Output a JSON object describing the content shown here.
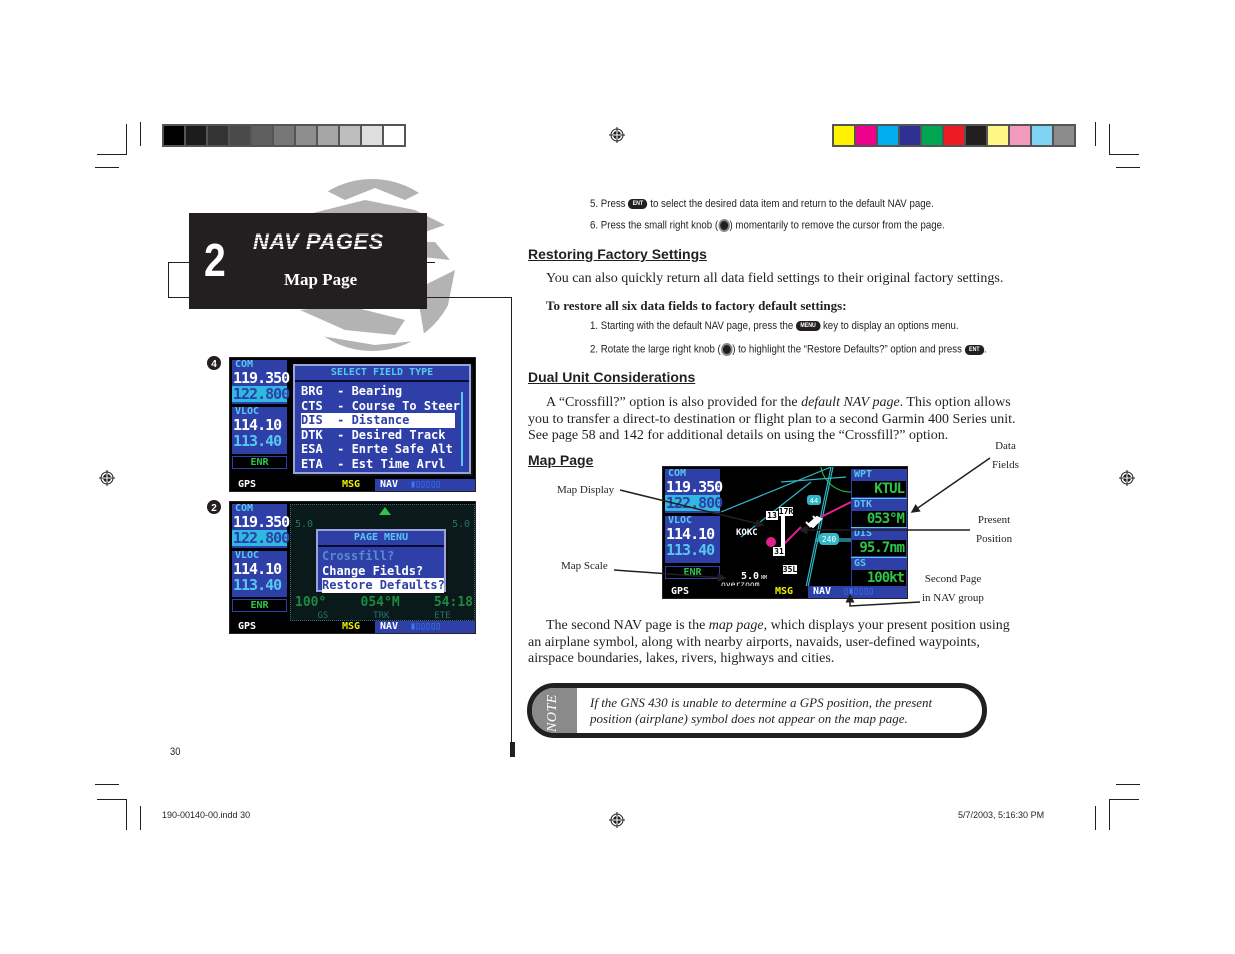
{
  "colors": {
    "gray_swatches": [
      "#000000",
      "#1c1c1c",
      "#333333",
      "#4a4a4a",
      "#5f5f5f",
      "#777777",
      "#8e8e8e",
      "#a6a6a6",
      "#bebebe",
      "#dedede",
      "#ffffff"
    ],
    "color_swatches": [
      "#fff200",
      "#ec008c",
      "#00aeef",
      "#2e3192",
      "#00a651",
      "#ed1c24",
      "#231f20",
      "#fff685",
      "#f49ac1",
      "#7fd4f5",
      "#8c8c8c"
    ],
    "gps_blue": "#2e3fa8",
    "gps_cyan": "#58c8f0",
    "gps_green": "#2ec44a",
    "route_magenta": "#e0208c"
  },
  "chapter": {
    "number": "2",
    "title": "NAV PAGES",
    "subtitle": "Map Page"
  },
  "figures": {
    "step4_marker": "4",
    "step2_marker": "2",
    "screen_select": {
      "com_label": "COM",
      "com_active": "119.350",
      "com_standby": "122.800",
      "vloc_label": "VLOC",
      "vloc_active": "114.10",
      "vloc_standby": "113.40",
      "mode": "ENR",
      "popup_title": "SELECT FIELD TYPE",
      "items": [
        {
          "code": "BRG",
          "desc": "Bearing"
        },
        {
          "code": "CTS",
          "desc": "Course To Steer"
        },
        {
          "code": "DIS",
          "desc": "Distance"
        },
        {
          "code": "DTK",
          "desc": "Desired Track"
        },
        {
          "code": "ESA",
          "desc": "Enrte Safe Alt"
        },
        {
          "code": "ETA",
          "desc": "Est Time Arvl"
        }
      ],
      "items_text": [
        "BRG  - Bearing",
        "CTS  - Course To Steer",
        "DIS  - Distance",
        "DTK  - Desired Track",
        "ESA  - Enrte Safe Alt",
        "ETA  - Est Time Arvl"
      ],
      "selected_index": 2,
      "status_gps": "GPS",
      "status_msg": "MSG",
      "status_nav": "NAV",
      "status_pages": "▮▯▯▯▯▯"
    },
    "screen_menu": {
      "com_label": "COM",
      "com_active": "119.350",
      "com_standby": "122.800",
      "vloc_label": "VLOC",
      "vloc_active": "114.10",
      "vloc_standby": "113.40",
      "mode": "ENR",
      "popup_title": "PAGE MENU",
      "items": [
        "Crossfill?",
        "Change Fields?",
        "Restore Defaults?"
      ],
      "selected_index": 2,
      "bg_scale_left": "5.0",
      "bg_scale_right": "5.0",
      "bg_values": [
        "100°",
        "054°M",
        "54:18"
      ],
      "bg_labels": [
        "GS",
        "TRK",
        "ETE"
      ],
      "status_gps": "GPS",
      "status_msg": "MSG",
      "status_nav": "NAV",
      "status_pages": "▮▯▯▯▯▯"
    },
    "screen_map": {
      "com_label": "COM",
      "com_active": "119.350",
      "com_standby": "122.800",
      "vloc_label": "VLOC",
      "vloc_active": "114.10",
      "vloc_standby": "113.40",
      "mode": "ENR",
      "airport": "KOKC",
      "runways": [
        "13",
        "17R",
        "31",
        "35L"
      ],
      "highways": [
        "44",
        "240"
      ],
      "scale": "5.0",
      "scale_unit": "NM",
      "overzoom": "overzoom",
      "fields": [
        {
          "label": "WPT",
          "value": "KTUL"
        },
        {
          "label": "DTK",
          "value": "053°M"
        },
        {
          "label": "DIS",
          "value": "95.7nm"
        },
        {
          "label": "GS",
          "value": "100kt"
        }
      ],
      "status_gps": "GPS",
      "status_msg": "MSG",
      "status_nav": "NAV",
      "status_pages": "▯▮▯▯▯▯"
    }
  },
  "steps_top": [
    {
      "prefix": "5. Press",
      "key": "ENT",
      "suffix": "to select the desired data item and return to the default NAV page."
    },
    {
      "prefix": "6. Press the small right knob (",
      "knob": "push-crsr-knob",
      "suffix": ") momentarily to remove the cursor from the page."
    }
  ],
  "restoring": {
    "heading": "Restoring Factory Settings",
    "intro": "You can also quickly return all data field settings to their original factory settings.",
    "procedure_title": "To restore all six data fields to factory default settings:",
    "step1_prefix": "1. Starting with the default NAV page, press the",
    "step1_key": "MENU",
    "step1_suffix": "key to display an options menu.",
    "step2_prefix": "2. Rotate the large right knob (",
    "step2_mid": ") to highlight the “Restore Defaults?” option and press",
    "step2_key": "ENT",
    "step2_suffix": "."
  },
  "dual_unit": {
    "heading": "Dual Unit Considerations",
    "text_a": "A “Crossfill?” option is also provided for the ",
    "text_em": "default NAV page",
    "text_b": ". This option allows you to transfer a direct-to destination or flight plan to a second Garmin 400 Series unit. See page 58 and 142 for additional details on using the “Crossfill?” option."
  },
  "map_page": {
    "heading": "Map Page",
    "callouts": {
      "map_display": "Map Display",
      "map_scale": "Map Scale",
      "data_fields_1": "Data",
      "data_fields_2": "Fields",
      "present_position_1": "Present",
      "present_position_2": "Position",
      "second_page_1": "Second Page",
      "second_page_2": "in NAV group"
    },
    "text_a": "The second NAV page is the ",
    "text_em": "map page",
    "text_b": ", which displays your present position using an airplane symbol, along with nearby airports, navaids, user-defined waypoints, airspace boundaries, lakes, rivers, highways and cities."
  },
  "note": {
    "label": "NOTE",
    "text": "If the GNS 430 is unable to determine a GPS position, the present position (airplane) symbol does not appear on the map page."
  },
  "footer": {
    "page_number": "30",
    "file_name": "190-00140-00.indd   30",
    "timestamp": "5/7/2003, 5:16:30 PM"
  }
}
